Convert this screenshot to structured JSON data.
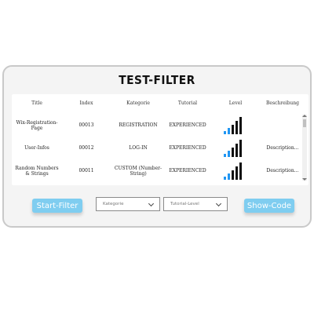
{
  "app": {
    "title": "TEST-FILTER"
  },
  "table": {
    "headers": [
      "Title",
      "Index",
      "Kategorie",
      "Tutorial",
      "Level",
      "Beschreibung"
    ],
    "rows": [
      {
        "title": "Wix-Registration-Page",
        "index": "00013",
        "kategorie": "REGISTRATION",
        "tutorial": "EXPERIENCED",
        "level_filled": 2,
        "beschreibung": ""
      },
      {
        "title": "User-Infos",
        "index": "00012",
        "kategorie": "LOG-IN",
        "tutorial": "EXPERIENCED",
        "level_filled": 2,
        "beschreibung": "Description..."
      },
      {
        "title": "Random Numbers & Strings",
        "index": "00011",
        "kategorie": "CUSTOM (Number-String)",
        "tutorial": "EXPERIENCED",
        "level_filled": 2,
        "beschreibung": "Description..."
      }
    ]
  },
  "controls": {
    "start_filter": "Start-Filter",
    "kategorie_placeholder": "Kategorie",
    "tutorial_level_placeholder": "Tutorial-Level",
    "show_code": "Show-Code"
  },
  "colors": {
    "accent": "#7fcdf0",
    "level_filled": "#2196f3",
    "level_empty": "#111111"
  },
  "icons": {
    "select": "chevron-down-icon"
  }
}
